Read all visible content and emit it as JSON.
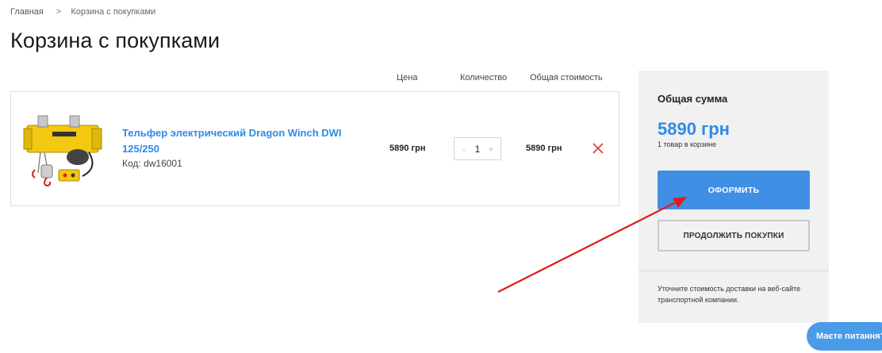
{
  "breadcrumb": {
    "home": "Главная",
    "separator": ">",
    "current": "Корзина с покупками"
  },
  "page_title": "Корзина с покупками",
  "table_headers": {
    "price": "Цена",
    "quantity": "Количество",
    "total": "Общая стоимость"
  },
  "cart_items": [
    {
      "name_line1": "Тельфер электрический Dragon Winch DWI",
      "name_line2": "125/250",
      "code": "Код: dw16001",
      "price": "5890 грн",
      "quantity": "1",
      "minus": "-",
      "plus": "+",
      "total": "5890 грн"
    }
  ],
  "summary": {
    "title": "Общая сумма",
    "amount": "5890 грн",
    "items_count": "1 товар в корзине",
    "checkout_label": "ОФОРМИТЬ",
    "continue_label": "ПРОДОЛЖИТЬ ПОКУПКИ",
    "note": "Уточните стоимость доставки на веб-сайте транспортной компании."
  },
  "chat": {
    "label": "Маєте питання?"
  },
  "colors": {
    "accent": "#2f8be6",
    "button": "#3f8fe4",
    "remove": "#d93a3a",
    "annotation_arrow": "#e11b1b",
    "summary_bg": "#f1f1f1"
  },
  "icons": {
    "remove": "close-x-icon",
    "breadcrumb_separator": "chevron-right-icon"
  }
}
